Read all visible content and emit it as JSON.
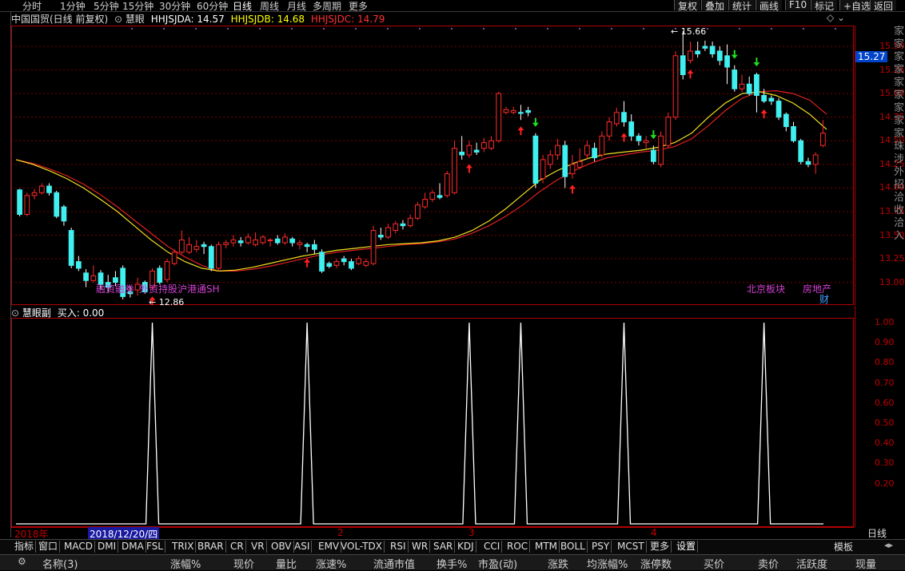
{
  "toolbar": {
    "periods": [
      "分时",
      "1分钟",
      "5分钟",
      "15分钟",
      "30分钟",
      "60分钟",
      "日线",
      "周线",
      "月线",
      "多周期",
      "更多"
    ],
    "active_period": "日线",
    "right_buttons": [
      "复权",
      "叠加",
      "统计",
      "画线",
      "F10",
      "标记",
      "+自选",
      "返回"
    ]
  },
  "header": {
    "stock_title": "中国国贸(日线 前复权)",
    "indicator_name": "慧眼",
    "line_a_label": "HHJSJDA: 14.57",
    "line_b_label": "HHJSJDB: 14.68",
    "line_c_label": "HHJSJDC: 14.79",
    "colors": {
      "a": "#ffffff",
      "b": "#ffff00",
      "c": "#ff3030"
    }
  },
  "main_chart": {
    "price_ticks": [
      "15.50",
      "15.25",
      "15.00",
      "14.75",
      "14.50",
      "14.25",
      "14.00",
      "13.75",
      "13.50",
      "13.25",
      "13.00"
    ],
    "current_price": "15.27",
    "high_label": "15.66",
    "low_label": "12.86",
    "concept_labels": [
      "融资融券",
      "外资持股",
      "沪港通SH",
      "北京板块",
      "房地产"
    ],
    "finance_tag": "财"
  },
  "sub_chart": {
    "title": "慧眼副",
    "value_label": "买入: 0.00",
    "ticks": [
      "1.00",
      "0.90",
      "0.80",
      "0.70",
      "0.60",
      "0.50",
      "0.40",
      "0.30",
      "0.20"
    ]
  },
  "date_bar": {
    "year_label": "2018年",
    "cursor_date": "2018/12/20/四",
    "month_marks": [
      "2",
      "3",
      "4"
    ],
    "period_label": "日线"
  },
  "indicator_tabs": [
    "指标",
    "窗口",
    "MACD",
    "DMI",
    "DMA",
    "FSL",
    "TRIX",
    "BRAR",
    "CR",
    "VR",
    "OBV",
    "ASI",
    "EMV",
    "VOL-TDX",
    "RSI",
    "WR",
    "SAR",
    "KDJ",
    "CCI",
    "ROC",
    "MTM",
    "BOLL",
    "PSY",
    "MCST",
    "更多",
    "设置"
  ],
  "template_label": "模板",
  "columns": [
    "名称(3)",
    "涨幅%",
    "现价",
    "量比",
    "涨速%",
    "流通市值",
    "换手%",
    "市盈(动)",
    "涨跌",
    "均涨幅%",
    "涨停数",
    "买价",
    "卖价",
    "活跃度",
    "现量"
  ],
  "right_strip_text": "家家家家家家家家家珠涉外招洽收洽入",
  "chart_data": {
    "type": "candlestick",
    "price_range": [
      12.76,
      15.72
    ],
    "candles": [
      [
        13.98,
        13.72,
        13.99,
        13.7
      ],
      [
        13.72,
        13.92,
        13.95,
        13.7
      ],
      [
        13.92,
        13.95,
        13.99,
        13.88
      ],
      [
        13.95,
        14.02,
        14.05,
        13.93
      ],
      [
        14.02,
        13.95,
        14.05,
        13.92
      ],
      [
        13.95,
        13.7,
        13.97,
        13.68
      ],
      [
        13.8,
        13.65,
        13.82,
        13.6
      ],
      [
        13.55,
        13.18,
        13.58,
        13.15
      ],
      [
        13.22,
        13.15,
        13.28,
        13.12
      ],
      [
        13.1,
        13.02,
        13.14,
        12.95
      ],
      [
        13.02,
        13.07,
        13.18,
        13.0
      ],
      [
        13.1,
        12.98,
        13.13,
        12.92
      ],
      [
        13.0,
        12.95,
        13.08,
        12.9
      ],
      [
        13.05,
        13.0,
        13.12,
        12.96
      ],
      [
        13.15,
        12.85,
        13.18,
        12.82
      ],
      [
        12.9,
        12.88,
        12.96,
        12.84
      ],
      [
        12.92,
        12.98,
        13.05,
        12.86
      ],
      [
        13.0,
        12.9,
        13.02,
        12.88
      ],
      [
        12.95,
        13.12,
        13.15,
        12.92
      ],
      [
        13.15,
        13.0,
        13.18,
        12.98
      ],
      [
        13.03,
        13.22,
        13.25,
        13.0
      ],
      [
        13.2,
        13.32,
        13.35,
        13.18
      ],
      [
        13.32,
        13.45,
        13.55,
        13.3
      ],
      [
        13.32,
        13.4,
        13.48,
        13.3
      ],
      [
        13.35,
        13.38,
        13.45,
        13.32
      ],
      [
        13.4,
        13.38,
        13.43,
        13.3
      ],
      [
        13.38,
        13.15,
        13.4,
        13.12
      ],
      [
        13.15,
        13.4,
        13.43,
        13.12
      ],
      [
        13.4,
        13.42,
        13.45,
        13.36
      ],
      [
        13.42,
        13.45,
        13.5,
        13.38
      ],
      [
        13.44,
        13.42,
        13.48,
        13.38
      ],
      [
        13.42,
        13.48,
        13.52,
        13.4
      ],
      [
        13.4,
        13.45,
        13.53,
        13.38
      ],
      [
        13.42,
        13.48,
        13.5,
        13.4
      ],
      [
        13.45,
        13.45,
        13.47,
        13.38
      ],
      [
        13.46,
        13.42,
        13.5,
        13.4
      ],
      [
        13.42,
        13.48,
        13.52,
        13.4
      ],
      [
        13.46,
        13.42,
        13.48,
        13.38
      ],
      [
        13.4,
        13.42,
        13.45,
        13.35
      ],
      [
        13.4,
        13.38,
        13.42,
        13.32
      ],
      [
        13.4,
        13.35,
        13.45,
        13.3
      ],
      [
        13.32,
        13.12,
        13.35,
        13.1
      ],
      [
        13.2,
        13.17,
        13.22,
        13.15
      ],
      [
        13.18,
        13.22,
        13.25,
        13.15
      ],
      [
        13.25,
        13.22,
        13.28,
        13.18
      ],
      [
        13.22,
        13.15,
        13.25,
        13.13
      ],
      [
        13.2,
        13.25,
        13.28,
        13.18
      ],
      [
        13.18,
        13.22,
        13.25,
        13.16
      ],
      [
        13.2,
        13.55,
        13.6,
        13.18
      ],
      [
        13.5,
        13.48,
        13.58,
        13.45
      ],
      [
        13.48,
        13.58,
        13.62,
        13.46
      ],
      [
        13.55,
        13.62,
        13.65,
        13.52
      ],
      [
        13.62,
        13.6,
        13.66,
        13.56
      ],
      [
        13.6,
        13.68,
        13.72,
        13.58
      ],
      [
        13.68,
        13.82,
        13.85,
        13.66
      ],
      [
        13.8,
        13.88,
        13.95,
        13.78
      ],
      [
        13.88,
        13.95,
        13.98,
        13.85
      ],
      [
        13.92,
        13.9,
        14.05,
        13.88
      ],
      [
        13.92,
        14.15,
        14.18,
        13.9
      ],
      [
        13.95,
        14.42,
        14.5,
        13.93
      ],
      [
        14.38,
        14.35,
        14.55,
        14.3
      ],
      [
        14.35,
        14.45,
        14.5,
        14.32
      ],
      [
        14.4,
        14.38,
        14.48,
        14.35
      ],
      [
        14.42,
        14.48,
        14.53,
        14.38
      ],
      [
        14.42,
        14.5,
        14.55,
        14.4
      ],
      [
        14.5,
        15.0,
        15.02,
        14.48
      ],
      [
        14.8,
        14.83,
        14.86,
        14.78
      ],
      [
        14.8,
        14.82,
        14.86,
        14.78
      ],
      [
        14.8,
        14.79,
        14.88,
        14.72
      ],
      [
        14.82,
        14.8,
        14.86,
        14.76
      ],
      [
        14.55,
        14.05,
        14.58,
        14.0
      ],
      [
        14.1,
        14.3,
        14.35,
        14.05
      ],
      [
        14.25,
        14.35,
        14.4,
        14.2
      ],
      [
        14.35,
        14.45,
        14.52,
        14.3
      ],
      [
        14.45,
        14.12,
        14.5,
        14.0
      ],
      [
        14.15,
        14.25,
        14.35,
        14.1
      ],
      [
        14.22,
        14.28,
        14.42,
        14.2
      ],
      [
        14.35,
        14.45,
        14.5,
        14.3
      ],
      [
        14.42,
        14.32,
        14.48,
        14.28
      ],
      [
        14.35,
        14.55,
        14.6,
        14.32
      ],
      [
        14.55,
        14.7,
        14.75,
        14.5
      ],
      [
        14.68,
        14.8,
        14.85,
        14.65
      ],
      [
        14.8,
        14.7,
        14.92,
        14.65
      ],
      [
        14.7,
        14.55,
        14.78,
        14.5
      ],
      [
        14.55,
        14.5,
        14.58,
        14.45
      ],
      [
        14.48,
        14.5,
        14.55,
        14.42
      ],
      [
        14.4,
        14.28,
        14.45,
        14.25
      ],
      [
        14.25,
        14.55,
        14.6,
        14.22
      ],
      [
        14.45,
        14.75,
        14.8,
        14.43
      ],
      [
        14.75,
        15.4,
        15.45,
        14.72
      ],
      [
        15.4,
        15.2,
        15.66,
        15.15
      ],
      [
        15.35,
        15.45,
        15.55,
        15.32
      ],
      [
        15.45,
        15.42,
        15.55,
        15.38
      ],
      [
        15.5,
        15.48,
        15.56,
        15.45
      ],
      [
        15.5,
        15.42,
        15.55,
        15.38
      ],
      [
        15.45,
        15.35,
        15.5,
        15.3
      ],
      [
        15.4,
        15.28,
        15.52,
        15.1
      ],
      [
        15.25,
        15.05,
        15.3,
        15.02
      ],
      [
        15.05,
        15.1,
        15.2,
        15.02
      ],
      [
        15.1,
        15.0,
        15.18,
        14.98
      ],
      [
        15.2,
        14.98,
        15.22,
        14.8
      ],
      [
        14.98,
        14.92,
        15.05,
        14.9
      ],
      [
        14.95,
        14.92,
        14.98,
        14.88
      ],
      [
        14.92,
        14.75,
        14.95,
        14.72
      ],
      [
        14.78,
        14.65,
        14.8,
        14.6
      ],
      [
        14.65,
        14.5,
        14.7,
        14.48
      ],
      [
        14.5,
        14.28,
        14.52,
        14.25
      ],
      [
        14.28,
        14.25,
        14.32,
        14.22
      ],
      [
        14.25,
        14.35,
        14.38,
        14.15
      ],
      [
        14.45,
        14.58,
        14.72,
        14.43
      ]
    ],
    "ma_yellow": [
      14.3,
      14.25,
      14.18,
      14.1,
      14.0,
      13.88,
      13.75,
      13.6,
      13.45,
      13.32,
      13.22,
      13.15,
      13.12,
      13.13,
      13.16,
      13.2,
      13.24,
      13.28,
      13.31,
      13.34,
      13.36,
      13.38,
      13.4,
      13.41,
      13.42,
      13.44,
      13.48,
      13.55,
      13.65,
      13.78,
      13.93,
      14.08,
      14.18,
      14.26,
      14.32,
      14.36,
      14.38,
      14.4,
      14.43,
      14.48,
      14.58,
      14.75,
      14.9,
      15.0,
      15.02,
      14.98,
      14.9,
      14.78,
      14.62
    ],
    "ma_red": [
      14.3,
      14.26,
      14.2,
      14.13,
      14.04,
      13.93,
      13.8,
      13.66,
      13.52,
      13.38,
      13.27,
      13.18,
      13.12,
      13.12,
      13.14,
      13.17,
      13.21,
      13.25,
      13.29,
      13.32,
      13.34,
      13.36,
      13.38,
      13.4,
      13.41,
      13.43,
      13.46,
      13.52,
      13.6,
      13.7,
      13.82,
      13.96,
      14.08,
      14.18,
      14.26,
      14.32,
      14.35,
      14.38,
      14.4,
      14.44,
      14.52,
      14.66,
      14.82,
      14.95,
      15.02,
      15.03,
      15.0,
      14.93,
      14.78
    ],
    "buy_signals_candle_index": [
      18,
      39,
      61,
      68,
      75,
      82,
      91,
      101
    ],
    "sell_signals_candle_index": [
      70,
      86,
      97,
      100
    ],
    "sub_spikes_candle_index": [
      18,
      39,
      61,
      68,
      82,
      101
    ],
    "sub_range": [
      0,
      1.0
    ]
  }
}
